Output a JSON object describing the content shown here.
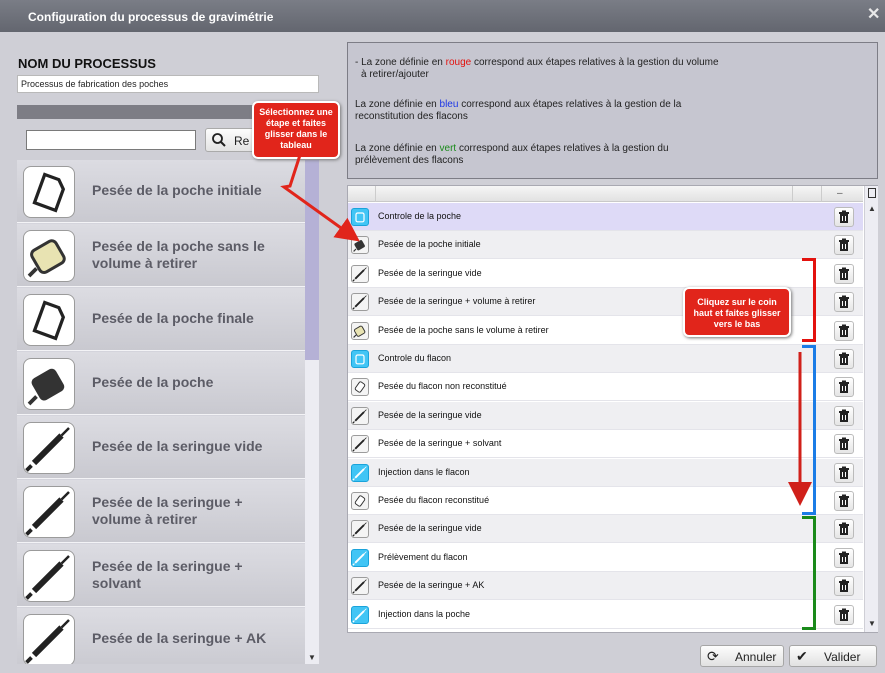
{
  "window": {
    "title": "Configuration du processus de gravimétrie"
  },
  "process": {
    "label": "NOM DU PROCESSUS",
    "name": "Processus de fabrication des poches"
  },
  "search": {
    "value": "",
    "button_label": "Re"
  },
  "steps": [
    {
      "label": "Pesée de la poche initiale",
      "icon": "bag-scale-icon"
    },
    {
      "label": "Pesée de la poche sans le volume à retirer",
      "icon": "bag-volume-icon"
    },
    {
      "label": "Pesée de la poche finale",
      "icon": "bag-scale-icon"
    },
    {
      "label": "Pesée de la poche",
      "icon": "bag-dark-icon"
    },
    {
      "label": "Pesée de la seringue vide",
      "icon": "syringe-icon"
    },
    {
      "label": "Pesée de la seringue + volume à retirer",
      "icon": "syringe-icon"
    },
    {
      "label": "Pesée de la seringue + solvant",
      "icon": "syringe-icon"
    },
    {
      "label": "Pesée de la seringue + AK",
      "icon": "syringe-icon"
    }
  ],
  "info": {
    "line1_a": "- La zone définie en ",
    "line1_color": "rouge",
    "line1_b": " correspond aux étapes relatives à la gestion du volume",
    "line1_c": "à retirer/ajouter",
    "line2_a": "La zone définie en ",
    "line2_color": "bleu",
    "line2_b": " correspond aux étapes relatives à la gestion de la",
    "line2_c": "reconstitution des flacons",
    "line3_a": "La zone définie en ",
    "line3_color": "vert",
    "line3_b": " correspond aux étapes relatives à la gestion du",
    "line3_c": "prélèvement des flacons"
  },
  "table_rows": [
    {
      "label": "Controle de la poche",
      "icon": "bag-check-icon",
      "state": "selected"
    },
    {
      "label": "Pesée de la poche initiale",
      "icon": "bag-dark-icon"
    },
    {
      "label": "Pesée de la seringue vide",
      "icon": "syringe-icon"
    },
    {
      "label": "Pesée de la seringue + volume à retirer",
      "icon": "syringe-icon"
    },
    {
      "label": "Pesée de la poche sans le volume à retirer",
      "icon": "bag-volume-icon"
    },
    {
      "label": "Controle du flacon",
      "icon": "vial-check-icon"
    },
    {
      "label": "Pesée du flacon non reconstitué",
      "icon": "vial-icon"
    },
    {
      "label": "Pesée de la seringue vide",
      "icon": "syringe-icon"
    },
    {
      "label": "Pesée de la seringue + solvant",
      "icon": "syringe-icon"
    },
    {
      "label": "Injection dans le flacon",
      "icon": "syringe-blue-icon"
    },
    {
      "label": "Pesée du flacon reconstitué",
      "icon": "vial-icon"
    },
    {
      "label": "Pesée de la seringue vide",
      "icon": "syringe-icon"
    },
    {
      "label": "Prélèvement du flacon",
      "icon": "syringe-blue-icon"
    },
    {
      "label": "Pesée de la seringue + AK",
      "icon": "syringe-icon"
    },
    {
      "label": "Injection dans la poche",
      "icon": "syringe-blue-icon"
    }
  ],
  "callouts": {
    "left": "Sélectionnez une étape et faites glisser dans le tableau",
    "right": "Cliquez sur le coin haut et faites glisser vers le bas"
  },
  "zone_colors": {
    "red": "#e3120e",
    "blue": "#1b7ce6",
    "green": "#1a8a1a"
  },
  "footer": {
    "cancel_label": "Annuler",
    "validate_label": "Valider"
  }
}
